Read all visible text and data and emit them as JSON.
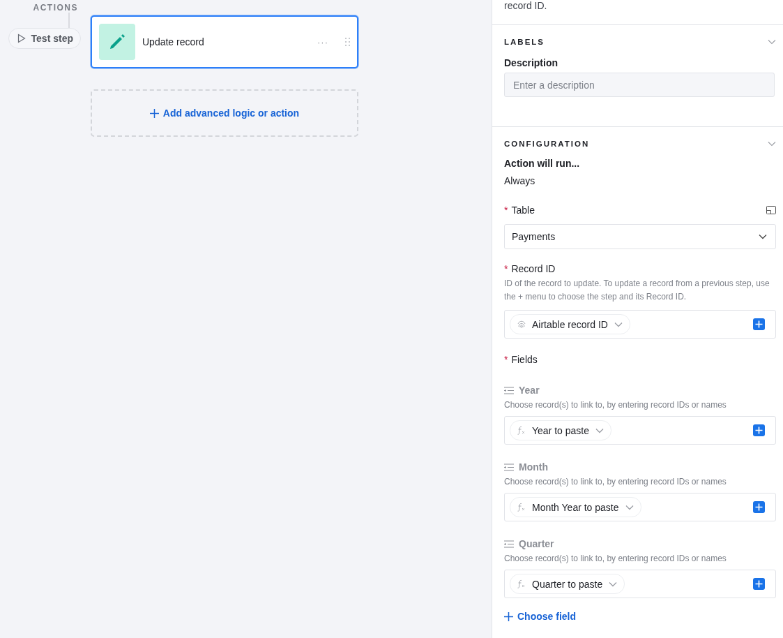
{
  "canvas": {
    "section_label": "ACTIONS",
    "test_step": {
      "label": "Test step"
    },
    "step_card": {
      "title": "Update record",
      "selected": true,
      "more": "···"
    },
    "add_action": {
      "label": "Add advanced logic or action"
    }
  },
  "panel": {
    "top_text": "record ID.",
    "labels_section": {
      "title": "LABELS",
      "expanded": true,
      "field_label": "Description",
      "placeholder": "Enter a description"
    },
    "config_section": {
      "title": "CONFIGURATION",
      "expanded": true,
      "run_label": "Action will run...",
      "run_value": "Always",
      "table": {
        "required_mark": "*",
        "label": "Table",
        "value": "Payments"
      },
      "record_id": {
        "required_mark": "*",
        "label": "Record ID",
        "help": "ID of the record to update. To update a record from a previous step, use the + menu to choose the step and its Record ID.",
        "token": {
          "kind": "record_id",
          "label": "Airtable record ID"
        }
      },
      "fields_label": {
        "required_mark": "*",
        "label": "Fields"
      },
      "fields": [
        {
          "name": "Year",
          "help": "Choose record(s) to link to, by entering record IDs or names",
          "token": {
            "kind": "formula",
            "label": "Year to paste"
          }
        },
        {
          "name": "Month",
          "help": "Choose record(s) to link to, by entering record IDs or names",
          "token": {
            "kind": "formula",
            "label": "Month Year to paste"
          }
        },
        {
          "name": "Quarter",
          "help": "Choose record(s) to link to, by entering record IDs or names",
          "token": {
            "kind": "formula",
            "label": "Quarter to paste"
          }
        }
      ],
      "choose_field": "Choose field"
    }
  }
}
